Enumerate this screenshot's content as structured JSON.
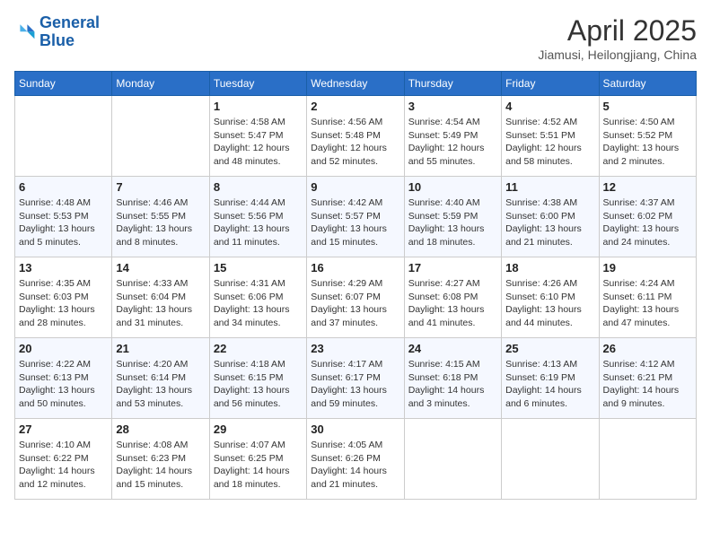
{
  "header": {
    "logo_line1": "General",
    "logo_line2": "Blue",
    "month": "April 2025",
    "location": "Jiamusi, Heilongjiang, China"
  },
  "weekdays": [
    "Sunday",
    "Monday",
    "Tuesday",
    "Wednesday",
    "Thursday",
    "Friday",
    "Saturday"
  ],
  "weeks": [
    [
      {
        "day": "",
        "sunrise": "",
        "sunset": "",
        "daylight": ""
      },
      {
        "day": "",
        "sunrise": "",
        "sunset": "",
        "daylight": ""
      },
      {
        "day": "1",
        "sunrise": "Sunrise: 4:58 AM",
        "sunset": "Sunset: 5:47 PM",
        "daylight": "Daylight: 12 hours and 48 minutes."
      },
      {
        "day": "2",
        "sunrise": "Sunrise: 4:56 AM",
        "sunset": "Sunset: 5:48 PM",
        "daylight": "Daylight: 12 hours and 52 minutes."
      },
      {
        "day": "3",
        "sunrise": "Sunrise: 4:54 AM",
        "sunset": "Sunset: 5:49 PM",
        "daylight": "Daylight: 12 hours and 55 minutes."
      },
      {
        "day": "4",
        "sunrise": "Sunrise: 4:52 AM",
        "sunset": "Sunset: 5:51 PM",
        "daylight": "Daylight: 12 hours and 58 minutes."
      },
      {
        "day": "5",
        "sunrise": "Sunrise: 4:50 AM",
        "sunset": "Sunset: 5:52 PM",
        "daylight": "Daylight: 13 hours and 2 minutes."
      }
    ],
    [
      {
        "day": "6",
        "sunrise": "Sunrise: 4:48 AM",
        "sunset": "Sunset: 5:53 PM",
        "daylight": "Daylight: 13 hours and 5 minutes."
      },
      {
        "day": "7",
        "sunrise": "Sunrise: 4:46 AM",
        "sunset": "Sunset: 5:55 PM",
        "daylight": "Daylight: 13 hours and 8 minutes."
      },
      {
        "day": "8",
        "sunrise": "Sunrise: 4:44 AM",
        "sunset": "Sunset: 5:56 PM",
        "daylight": "Daylight: 13 hours and 11 minutes."
      },
      {
        "day": "9",
        "sunrise": "Sunrise: 4:42 AM",
        "sunset": "Sunset: 5:57 PM",
        "daylight": "Daylight: 13 hours and 15 minutes."
      },
      {
        "day": "10",
        "sunrise": "Sunrise: 4:40 AM",
        "sunset": "Sunset: 5:59 PM",
        "daylight": "Daylight: 13 hours and 18 minutes."
      },
      {
        "day": "11",
        "sunrise": "Sunrise: 4:38 AM",
        "sunset": "Sunset: 6:00 PM",
        "daylight": "Daylight: 13 hours and 21 minutes."
      },
      {
        "day": "12",
        "sunrise": "Sunrise: 4:37 AM",
        "sunset": "Sunset: 6:02 PM",
        "daylight": "Daylight: 13 hours and 24 minutes."
      }
    ],
    [
      {
        "day": "13",
        "sunrise": "Sunrise: 4:35 AM",
        "sunset": "Sunset: 6:03 PM",
        "daylight": "Daylight: 13 hours and 28 minutes."
      },
      {
        "day": "14",
        "sunrise": "Sunrise: 4:33 AM",
        "sunset": "Sunset: 6:04 PM",
        "daylight": "Daylight: 13 hours and 31 minutes."
      },
      {
        "day": "15",
        "sunrise": "Sunrise: 4:31 AM",
        "sunset": "Sunset: 6:06 PM",
        "daylight": "Daylight: 13 hours and 34 minutes."
      },
      {
        "day": "16",
        "sunrise": "Sunrise: 4:29 AM",
        "sunset": "Sunset: 6:07 PM",
        "daylight": "Daylight: 13 hours and 37 minutes."
      },
      {
        "day": "17",
        "sunrise": "Sunrise: 4:27 AM",
        "sunset": "Sunset: 6:08 PM",
        "daylight": "Daylight: 13 hours and 41 minutes."
      },
      {
        "day": "18",
        "sunrise": "Sunrise: 4:26 AM",
        "sunset": "Sunset: 6:10 PM",
        "daylight": "Daylight: 13 hours and 44 minutes."
      },
      {
        "day": "19",
        "sunrise": "Sunrise: 4:24 AM",
        "sunset": "Sunset: 6:11 PM",
        "daylight": "Daylight: 13 hours and 47 minutes."
      }
    ],
    [
      {
        "day": "20",
        "sunrise": "Sunrise: 4:22 AM",
        "sunset": "Sunset: 6:13 PM",
        "daylight": "Daylight: 13 hours and 50 minutes."
      },
      {
        "day": "21",
        "sunrise": "Sunrise: 4:20 AM",
        "sunset": "Sunset: 6:14 PM",
        "daylight": "Daylight: 13 hours and 53 minutes."
      },
      {
        "day": "22",
        "sunrise": "Sunrise: 4:18 AM",
        "sunset": "Sunset: 6:15 PM",
        "daylight": "Daylight: 13 hours and 56 minutes."
      },
      {
        "day": "23",
        "sunrise": "Sunrise: 4:17 AM",
        "sunset": "Sunset: 6:17 PM",
        "daylight": "Daylight: 13 hours and 59 minutes."
      },
      {
        "day": "24",
        "sunrise": "Sunrise: 4:15 AM",
        "sunset": "Sunset: 6:18 PM",
        "daylight": "Daylight: 14 hours and 3 minutes."
      },
      {
        "day": "25",
        "sunrise": "Sunrise: 4:13 AM",
        "sunset": "Sunset: 6:19 PM",
        "daylight": "Daylight: 14 hours and 6 minutes."
      },
      {
        "day": "26",
        "sunrise": "Sunrise: 4:12 AM",
        "sunset": "Sunset: 6:21 PM",
        "daylight": "Daylight: 14 hours and 9 minutes."
      }
    ],
    [
      {
        "day": "27",
        "sunrise": "Sunrise: 4:10 AM",
        "sunset": "Sunset: 6:22 PM",
        "daylight": "Daylight: 14 hours and 12 minutes."
      },
      {
        "day": "28",
        "sunrise": "Sunrise: 4:08 AM",
        "sunset": "Sunset: 6:23 PM",
        "daylight": "Daylight: 14 hours and 15 minutes."
      },
      {
        "day": "29",
        "sunrise": "Sunrise: 4:07 AM",
        "sunset": "Sunset: 6:25 PM",
        "daylight": "Daylight: 14 hours and 18 minutes."
      },
      {
        "day": "30",
        "sunrise": "Sunrise: 4:05 AM",
        "sunset": "Sunset: 6:26 PM",
        "daylight": "Daylight: 14 hours and 21 minutes."
      },
      {
        "day": "",
        "sunrise": "",
        "sunset": "",
        "daylight": ""
      },
      {
        "day": "",
        "sunrise": "",
        "sunset": "",
        "daylight": ""
      },
      {
        "day": "",
        "sunrise": "",
        "sunset": "",
        "daylight": ""
      }
    ]
  ]
}
